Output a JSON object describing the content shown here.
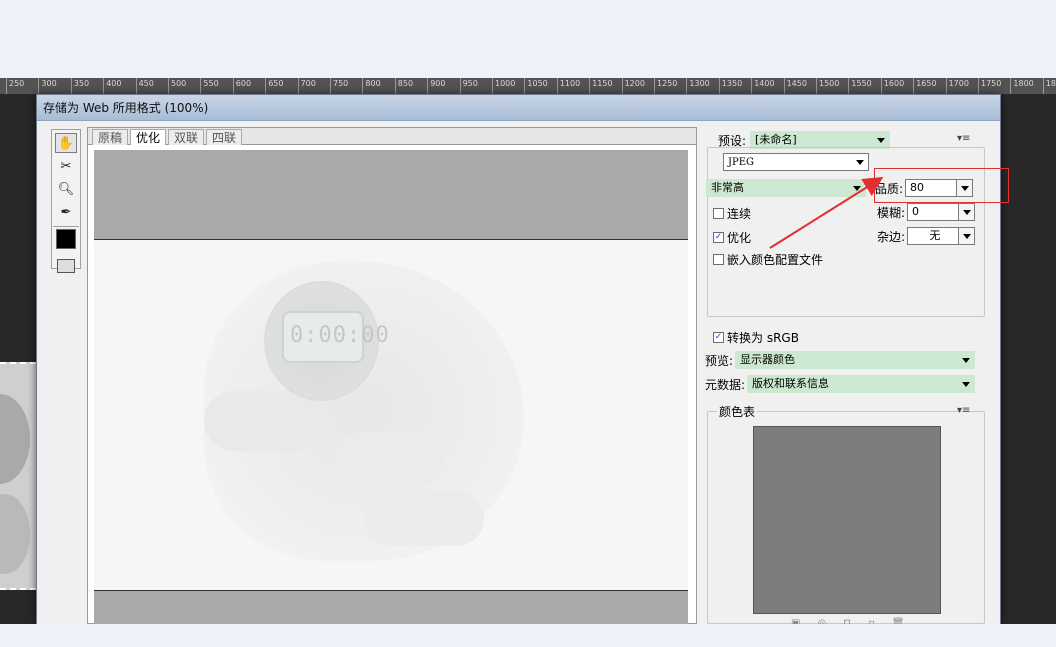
{
  "ruler": {
    "ticks": [
      "250",
      "300",
      "350",
      "400",
      "450",
      "500",
      "550",
      "600",
      "650",
      "700",
      "750",
      "800",
      "850",
      "900",
      "950",
      "1000",
      "1050",
      "1100",
      "1150",
      "1200",
      "1250",
      "1300",
      "1350",
      "1400",
      "1450",
      "1500",
      "1550",
      "1600",
      "1650",
      "1700",
      "1750",
      "1800",
      "18"
    ]
  },
  "dialog": {
    "title": "存储为 Web 所用格式 (100%)"
  },
  "tools": {
    "icons": [
      "hand-icon",
      "slice-select-icon",
      "zoom-icon",
      "eyedropper-icon",
      "color-swatch-icon",
      "preview-toggle-icon"
    ],
    "swatch_color": "#000000"
  },
  "view": {
    "tabs": [
      "原稿",
      "优化",
      "双联",
      "四联"
    ],
    "active_tab": "优化",
    "watch_digits": "0:00:00"
  },
  "settings": {
    "preset_label": "预设:",
    "preset_value": "[未命名]",
    "format_value": "JPEG",
    "quality_level": "非常高",
    "quality_label": "品质:",
    "quality_value": "80",
    "progressive_label": "连续",
    "progressive_checked": false,
    "blur_label": "模糊:",
    "blur_value": "0",
    "optimized_label": "优化",
    "optimized_checked": true,
    "matte_label": "杂边:",
    "matte_value": "无",
    "embed_profile_label": "嵌入颜色配置文件",
    "embed_profile_checked": false,
    "convert_srgb_label": "转换为 sRGB",
    "convert_srgb_checked": true,
    "preview_label": "预览:",
    "preview_value": "显示器颜色",
    "metadata_label": "元数据:",
    "metadata_value": "版权和联系信息",
    "color_table_label": "颜色表",
    "check_mark": "✓"
  },
  "annotation": {
    "color": "#e03030"
  }
}
